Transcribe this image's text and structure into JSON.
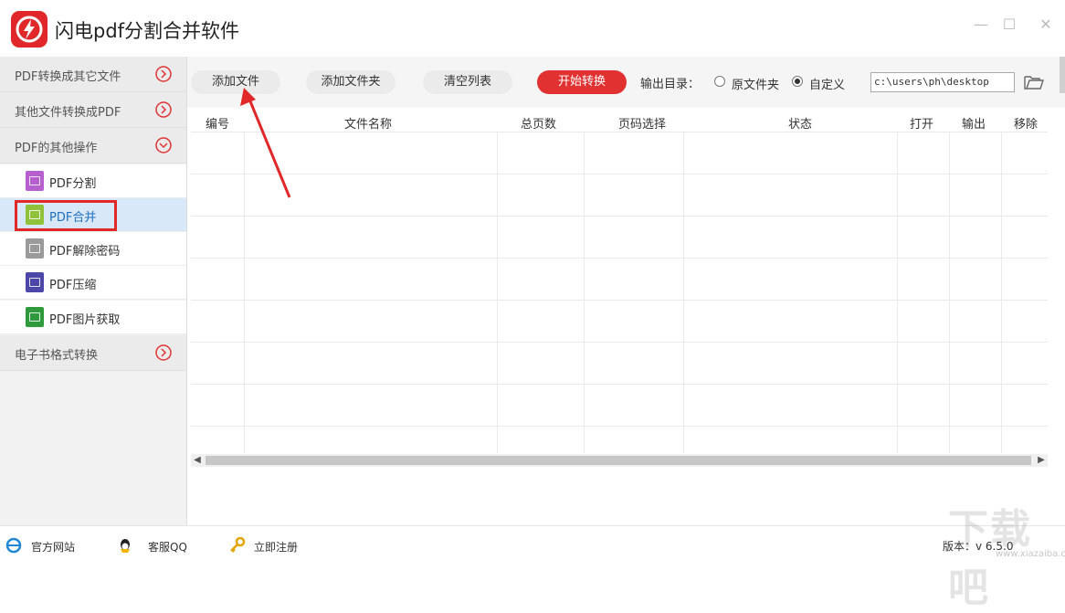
{
  "app": {
    "title": "闪电pdf分割合并软件",
    "brand_color": "#e0282a"
  },
  "window_controls": {
    "minimize": "—",
    "maximize": "☐",
    "close": "✕"
  },
  "sidebar": {
    "categories": [
      {
        "label": "PDF转换成其它文件",
        "icon": "chevron-right-circle-icon"
      },
      {
        "label": "其他文件转换成PDF",
        "icon": "chevron-right-circle-icon"
      },
      {
        "label": "PDF的其他操作",
        "icon": "chevron-down-circle-icon"
      },
      {
        "label": "电子书格式转换",
        "icon": "chevron-right-circle-icon"
      }
    ],
    "items": [
      {
        "label": "PDF分割",
        "icon_color": "#b85fcf"
      },
      {
        "label": "PDF合并",
        "icon_color": "#8fc23a",
        "active": true
      },
      {
        "label": "PDF解除密码",
        "icon_color": "#9a9a9a"
      },
      {
        "label": "PDF压缩",
        "icon_color": "#4b46a8"
      },
      {
        "label": "PDF图片获取",
        "icon_color": "#2e9a3c"
      }
    ]
  },
  "toolbar": {
    "add_file": "添加文件",
    "add_folder": "添加文件夹",
    "clear_list": "清空列表",
    "start_convert": "开始转换",
    "output_dir_label": "输出目录：",
    "option_original": "原文件夹",
    "option_custom": "自定义",
    "selected_option": "自定义",
    "path_value": "c:\\users\\ph\\desktop"
  },
  "table": {
    "columns": [
      "编号",
      "文件名称",
      "总页数",
      "页码选择",
      "状态",
      "打开",
      "输出",
      "移除"
    ],
    "rows": []
  },
  "statusbar": {
    "official_site": "官方网站",
    "customer_service": "客服QQ",
    "register": "立即注册",
    "version": "版本：v 6.5.0"
  },
  "watermark": {
    "text": "下载吧",
    "sub": "www.xiazaiba.com"
  }
}
